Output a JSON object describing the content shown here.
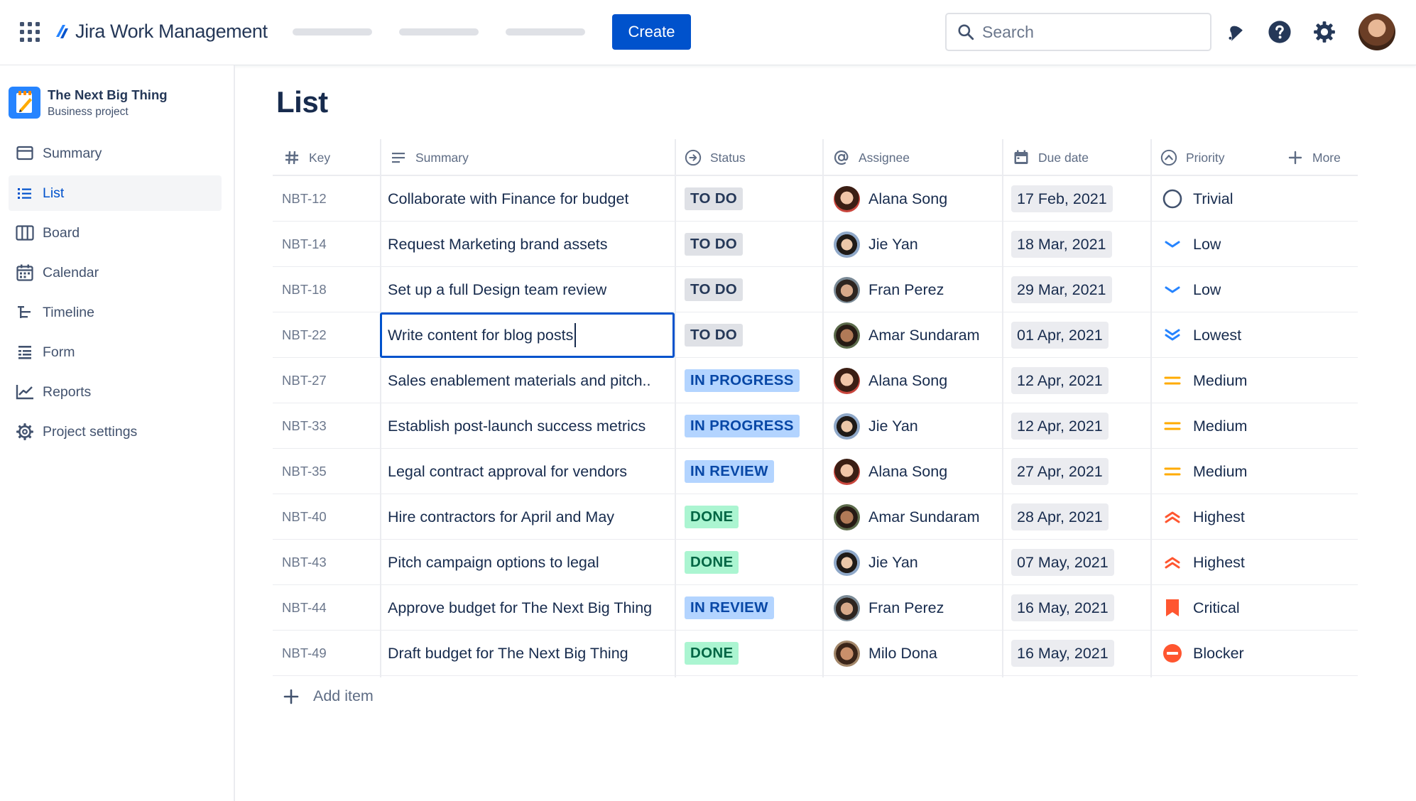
{
  "app": {
    "brand": "Jira Work Management",
    "create_label": "Create",
    "search_placeholder": "Search"
  },
  "sidebar": {
    "project_name": "The Next Big Thing",
    "project_type": "Business project",
    "items": [
      {
        "label": "Summary",
        "icon": "summary-icon"
      },
      {
        "label": "List",
        "icon": "list-icon",
        "active": true
      },
      {
        "label": "Board",
        "icon": "board-icon"
      },
      {
        "label": "Calendar",
        "icon": "calendar-icon"
      },
      {
        "label": "Timeline",
        "icon": "timeline-icon"
      },
      {
        "label": "Form",
        "icon": "form-icon"
      },
      {
        "label": "Reports",
        "icon": "reports-icon"
      },
      {
        "label": "Project settings",
        "icon": "gear-icon"
      }
    ]
  },
  "main": {
    "title": "List",
    "columns": {
      "key": "Key",
      "summary": "Summary",
      "status": "Status",
      "assignee": "Assignee",
      "due": "Due date",
      "priority": "Priority",
      "more": "More"
    },
    "rows": [
      {
        "key": "NBT-12",
        "summary": "Collaborate with Finance for budget",
        "status": "TO DO",
        "assignee": "Alana Song",
        "due": "17 Feb, 2021",
        "priority": "Trivial"
      },
      {
        "key": "NBT-14",
        "summary": "Request Marketing brand assets",
        "status": "TO DO",
        "assignee": "Jie Yan",
        "due": "18 Mar, 2021",
        "priority": "Low"
      },
      {
        "key": "NBT-18",
        "summary": "Set up a full Design team review",
        "status": "TO DO",
        "assignee": "Fran Perez",
        "due": "29 Mar, 2021",
        "priority": "Low"
      },
      {
        "key": "NBT-22",
        "summary": "Write content for blog posts",
        "status": "TO DO",
        "assignee": "Amar Sundaram",
        "due": "01 Apr, 2021",
        "priority": "Lowest",
        "editing": true
      },
      {
        "key": "NBT-27",
        "summary": "Sales enablement materials and pitch..",
        "status": "IN PROGRESS",
        "assignee": "Alana Song",
        "due": "12 Apr, 2021",
        "priority": "Medium"
      },
      {
        "key": "NBT-33",
        "summary": "Establish post-launch success metrics",
        "status": "IN PROGRESS",
        "assignee": "Jie Yan",
        "due": "12 Apr, 2021",
        "priority": "Medium"
      },
      {
        "key": "NBT-35",
        "summary": "Legal contract approval for vendors",
        "status": "IN REVIEW",
        "assignee": "Alana Song",
        "due": "27 Apr, 2021",
        "priority": "Medium"
      },
      {
        "key": "NBT-40",
        "summary": "Hire contractors for April and May",
        "status": "DONE",
        "assignee": "Amar Sundaram",
        "due": "28 Apr, 2021",
        "priority": "Highest"
      },
      {
        "key": "NBT-43",
        "summary": "Pitch campaign options to legal",
        "status": "DONE",
        "assignee": "Jie Yan",
        "due": "07 May, 2021",
        "priority": "Highest"
      },
      {
        "key": "NBT-44",
        "summary": "Approve budget for The Next Big Thing",
        "status": "IN REVIEW",
        "assignee": "Fran Perez",
        "due": "16 May, 2021",
        "priority": "Critical"
      },
      {
        "key": "NBT-49",
        "summary": "Draft budget for The Next Big Thing",
        "status": "DONE",
        "assignee": "Milo Dona",
        "due": "16 May, 2021",
        "priority": "Blocker"
      }
    ],
    "add_item_label": "Add item"
  },
  "colors": {
    "accent": "#0052CC",
    "status_todo_bg": "#DFE1E6",
    "status_todo_fg": "#253858",
    "status_inprogress_bg": "#B3D4FF",
    "status_inprogress_fg": "#0747A6",
    "status_done_bg": "#ABF5D1",
    "status_done_fg": "#006644",
    "priority_low": "#2684FF",
    "priority_medium": "#FFAB00",
    "priority_high": "#FF5630"
  }
}
